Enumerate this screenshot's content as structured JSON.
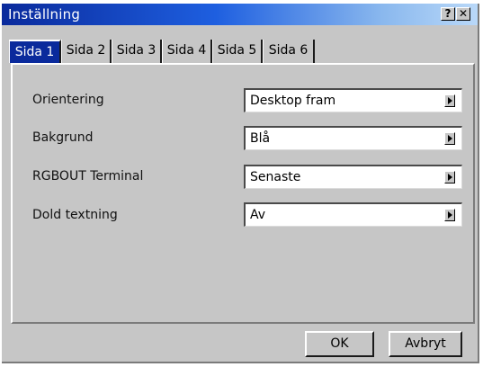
{
  "window": {
    "title": "Inställning",
    "help_glyph": "?",
    "close_glyph": "✕"
  },
  "tabs": [
    {
      "label": "Sida 1",
      "active": true
    },
    {
      "label": "Sida 2",
      "active": false
    },
    {
      "label": "Sida 3",
      "active": false
    },
    {
      "label": "Sida 4",
      "active": false
    },
    {
      "label": "Sida 5",
      "active": false
    },
    {
      "label": "Sida 6",
      "active": false
    }
  ],
  "settings": [
    {
      "label": "Orientering",
      "value": "Desktop fram"
    },
    {
      "label": "Bakgrund",
      "value": "Blå"
    },
    {
      "label": "RGBOUT Terminal",
      "value": "Senaste"
    },
    {
      "label": "Dold textning",
      "value": "Av"
    }
  ],
  "buttons": {
    "ok": "OK",
    "cancel": "Avbryt"
  },
  "colors": {
    "title_bar_start": "#0a2a9c",
    "title_bar_end": "#b9d8f8",
    "active_tab": "#0a2a9c",
    "dialog_face": "#c6c6c6"
  }
}
